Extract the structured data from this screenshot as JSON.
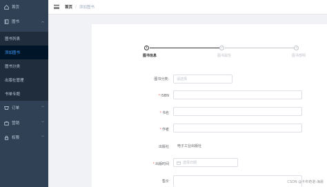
{
  "sidebar": {
    "items": [
      {
        "label": "首页",
        "icon": "home-icon"
      },
      {
        "label": "图书",
        "icon": "book-icon"
      },
      {
        "label": "图书列表"
      },
      {
        "label": "添加图书"
      },
      {
        "label": "图书分类"
      },
      {
        "label": "出版社管理"
      },
      {
        "label": "书单专题"
      },
      {
        "label": "订单",
        "icon": "order-icon"
      },
      {
        "label": "营销",
        "icon": "marketing-icon"
      },
      {
        "label": "权限",
        "icon": "permission-icon"
      }
    ]
  },
  "header": {
    "breadcrumb_home": "首页",
    "breadcrumb_separator": "/",
    "breadcrumb_current": "添加图书"
  },
  "steps": [
    {
      "number": "1",
      "label": "图书信息",
      "state": "active"
    },
    {
      "number": "2",
      "label": "图书属性",
      "state": "wait"
    },
    {
      "number": "3",
      "label": "图书部明",
      "state": "wait"
    }
  ],
  "form": {
    "category_label": "图书分类:",
    "category_placeholder": "请选择",
    "isbn_label": "ISBN",
    "title_label": "书名",
    "author_label": "作者",
    "publisher_label": "出版社",
    "publisher_value": "电子工业出版社",
    "pubdate_label": "出版时间",
    "pubdate_placeholder": "选择日期",
    "price_label": "售价"
  },
  "watermark": "CSDN @卡布奇诺-海晨",
  "colors": {
    "sidebar_bg": "#304156",
    "submenu_bg": "#1f2d3d",
    "active_item": "#409eff",
    "required_mark": "#f56c6c"
  }
}
